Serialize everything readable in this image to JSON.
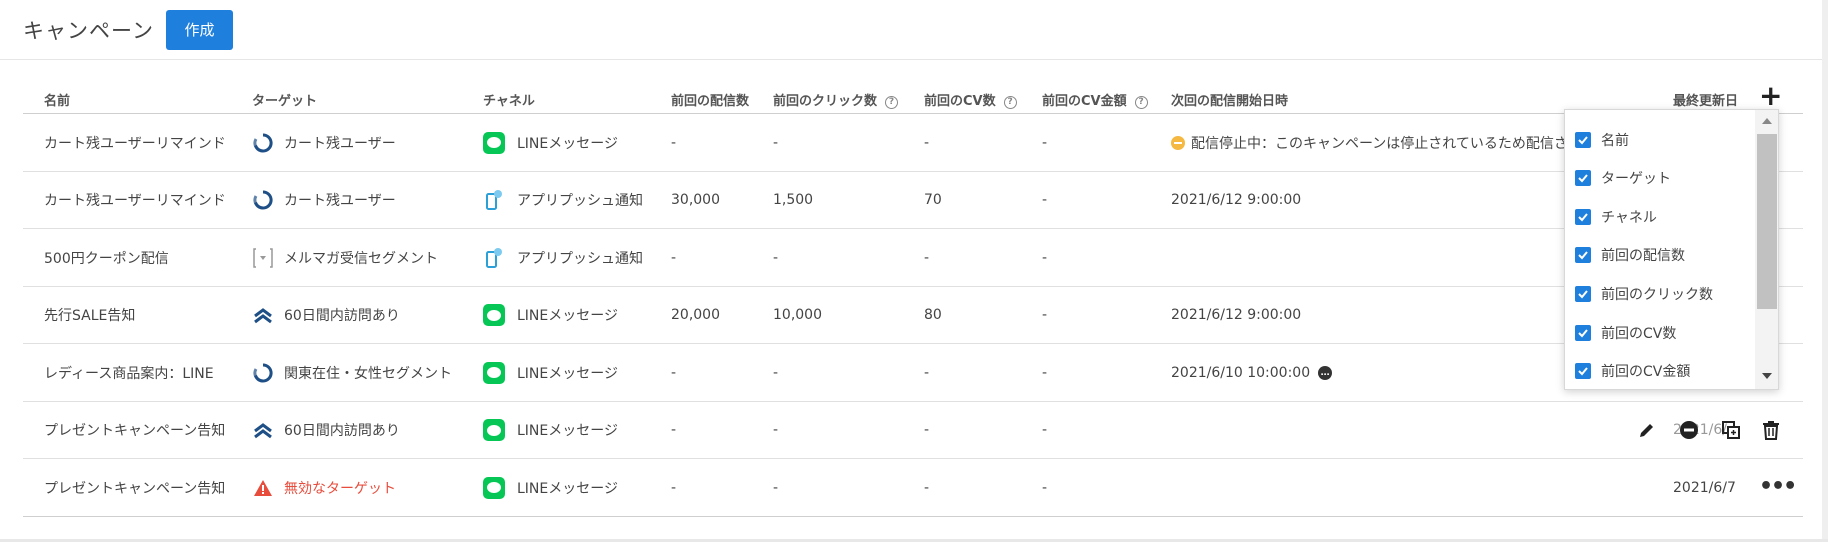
{
  "header": {
    "title": "キャンペーン",
    "create_label": "作成"
  },
  "table": {
    "columns": {
      "name": "名前",
      "target": "ターゲット",
      "channel": "チャネル",
      "sent": "前回の配信数",
      "click": "前回のクリック数",
      "cv": "前回のCV数",
      "cvamt": "前回のCV金額",
      "next": "次回の配信開始日時",
      "updated": "最終更新日"
    },
    "rows": [
      {
        "name": "カート残ユーザーリマインド",
        "target": "カート残ユーザー",
        "target_icon": "cycle-icon",
        "channel": "LINEメッセージ",
        "channel_icon": "line-icon",
        "sent": "-",
        "click": "-",
        "cv": "-",
        "cvamt": "-",
        "next": "配信停止中：このキャンペーンは停止されているため配信され",
        "updated": ""
      },
      {
        "name": "カート残ユーザーリマインド",
        "target": "カート残ユーザー",
        "target_icon": "cycle-icon",
        "channel": "アプリプッシュ通知",
        "channel_icon": "phone-icon",
        "sent": "30,000",
        "click": "1,500",
        "cv": "70",
        "cvamt": "-",
        "next": "2021/6/12 9:00:00",
        "updated": ""
      },
      {
        "name": "500円クーポン配信",
        "target": "メルマガ受信セグメント",
        "target_icon": "segment-icon",
        "channel": "アプリプッシュ通知",
        "channel_icon": "phone-icon",
        "sent": "-",
        "click": "-",
        "cv": "-",
        "cvamt": "-",
        "next": "",
        "updated": ""
      },
      {
        "name": "先行SALE告知",
        "target": "60日間内訪問あり",
        "target_icon": "chevron-up-icon",
        "channel": "LINEメッセージ",
        "channel_icon": "line-icon",
        "sent": "20,000",
        "click": "10,000",
        "cv": "80",
        "cvamt": "-",
        "next": "2021/6/12 9:00:00",
        "updated": ""
      },
      {
        "name": "レディース商品案内：LINE",
        "target": "関東在住・女性セグメント",
        "target_icon": "cycle-icon",
        "channel": "LINEメッセージ",
        "channel_icon": "line-icon",
        "sent": "-",
        "click": "-",
        "cv": "-",
        "cvamt": "-",
        "next": "2021/6/10 10:00:00",
        "updated": ""
      },
      {
        "name": "プレゼントキャンペーン告知",
        "target": "60日間内訪問あり",
        "target_icon": "chevron-up-icon",
        "channel": "LINEメッセージ",
        "channel_icon": "line-icon",
        "sent": "-",
        "click": "-",
        "cv": "-",
        "cvamt": "-",
        "next": "",
        "updated": "2021/6/"
      },
      {
        "name": "プレゼントキャンペーン告知",
        "target": "無効なターゲット",
        "target_icon": "warning-icon",
        "channel": "LINEメッセージ",
        "channel_icon": "line-icon",
        "sent": "-",
        "click": "-",
        "cv": "-",
        "cvamt": "-",
        "next": "",
        "updated": "2021/6/7"
      }
    ]
  },
  "column_picker": {
    "items": [
      "名前",
      "ターゲット",
      "チャネル",
      "前回の配信数",
      "前回のクリック数",
      "前回のCV数",
      "前回のCV金額"
    ]
  },
  "colors": {
    "accent": "#1f7fdd",
    "line_green": "#06c755",
    "invalid": "#e74c3c",
    "paused": "#f5b841"
  }
}
